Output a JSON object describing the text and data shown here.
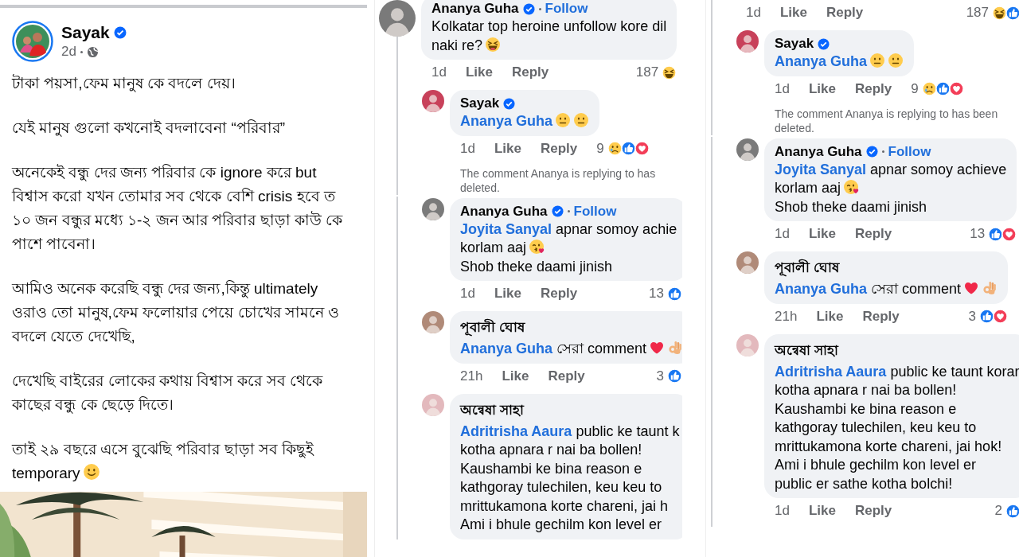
{
  "post": {
    "author": "Sayak",
    "verified": true,
    "time": "2d",
    "paragraphs": [
      {
        "lines": [
          {
            "text": "টাকা পয়সা,ফেম মানুষ কে বদলে দেয়।"
          }
        ]
      },
      {
        "lines": [
          {
            "text": "যেই মানুষ গুলো কখনোই বদলাবেনা “পরিবার”"
          }
        ]
      },
      {
        "lines": [
          {
            "text": "অনেকেই বন্ধু দের জন্য পরিবার কে ignore করে but"
          },
          {
            "text": "বিশ্বাস করো যখন তোমার সব থেকে বেশি crisis হবে ত"
          },
          {
            "text": "১০ জন বন্ধুর মধ্যে ১-২ জন আর পরিবার ছাড়া কাউ কে"
          },
          {
            "text": "পাশে পাবেনা।"
          }
        ]
      },
      {
        "lines": [
          {
            "text": "আমিও অনেক করেছি বন্ধু দের জন্য,কিন্তু ultimately"
          },
          {
            "text": "ওরাও তো মানুষ,ফেম ফলোয়ার পেয়ে চোখের সামনে ও"
          },
          {
            "text": "বদলে যেতে দেখেছি,"
          }
        ]
      },
      {
        "lines": [
          {
            "text": "দেখেছি বাইরের লোকের কথায় বিশ্বাস করে সব থেকে"
          },
          {
            "text": "কাছের বন্ধু কে ছেড়ে দিতে।"
          }
        ]
      },
      {
        "lines": [
          {
            "text": "তাই ২৯ বছরে এসে বুঝেছি পরিবার ছাড়া সব কিছুই"
          },
          {
            "text": "temporary",
            "emojis": [
              {
                "kind": "smile"
              }
            ]
          }
        ]
      }
    ]
  },
  "threads": [
    {
      "items": [
        {
          "kind": "comment",
          "author": "Ananya Guha",
          "verified": true,
          "follow": "Follow",
          "color": "#7a7a7a",
          "lines": [
            {
              "text": "Kolkatar top heroine unfollow kore dil"
            },
            {
              "text": "naki re?",
              "emojis": [
                {
                  "kind": "laugh"
                }
              ]
            }
          ],
          "meta": {
            "time": "1d",
            "like": "Like",
            "reply": "Reply",
            "count": "187",
            "reactions": [
              {
                "kind": "haha"
              }
            ]
          }
        },
        {
          "kind": "reply",
          "author": "Sayak",
          "verified": true,
          "color": "#c8415a",
          "lines": [
            {
              "mention": "Ananya Guha",
              "emojis": [
                {
                  "kind": "neutral"
                },
                {
                  "kind": "neutral"
                }
              ]
            }
          ],
          "meta": {
            "time": "1d",
            "like": "Like",
            "reply": "Reply",
            "count": "9",
            "reactions": [
              {
                "kind": "sad"
              },
              {
                "kind": "like"
              },
              {
                "kind": "love"
              }
            ]
          }
        },
        {
          "kind": "notice",
          "lines": [
            "The comment Ananya is replying to has",
            "deleted."
          ]
        },
        {
          "kind": "reply",
          "author": "Ananya Guha",
          "verified": true,
          "follow": "Follow",
          "color": "#7a7a7a",
          "lines": [
            {
              "mention": "Joyita Sanyal",
              "text": "apnar somoy achie"
            },
            {
              "text": "korlam aaj",
              "emojis": [
                {
                  "kind": "kiss"
                }
              ]
            },
            {
              "text": "Shob theke daami jinish"
            }
          ],
          "meta": {
            "time": "1d",
            "like": "Like",
            "reply": "Reply",
            "count": "13",
            "reactions": [
              {
                "kind": "like"
              }
            ]
          }
        },
        {
          "kind": "reply",
          "author": "পূবালী ঘোষ",
          "verified": false,
          "color": "#b08a78",
          "lines": [
            {
              "mention": "Ananya Guha",
              "text": "সেরা comment",
              "emojis": [
                {
                  "kind": "heart"
                },
                {
                  "kind": "ok"
                }
              ]
            }
          ],
          "meta": {
            "time": "21h",
            "like": "Like",
            "reply": "Reply",
            "count": "3",
            "reactions": [
              {
                "kind": "like"
              }
            ]
          }
        },
        {
          "kind": "reply",
          "author": "অন্বেষা সাহা",
          "verified": false,
          "color": "#e3b9bd",
          "lines": [
            {
              "mention": "Adritrisha Aaura",
              "text": "public ke taunt k"
            },
            {
              "text": "kotha apnara r nai ba bollen!"
            },
            {
              "text": "Kaushambi ke bina reason e"
            },
            {
              "text": "kathgoray tulechilen, keu keu to"
            },
            {
              "text": "mrittukamona korte chareni, jai h"
            },
            {
              "text": "Ami i bhule gechilm kon level er"
            }
          ]
        }
      ]
    },
    {
      "items": [
        {
          "kind": "meta",
          "meta": {
            "time": "1d",
            "like": "Like",
            "reply": "Reply",
            "count": "187",
            "reactions": [
              {
                "kind": "haha"
              },
              {
                "kind": "like"
              }
            ]
          }
        },
        {
          "kind": "reply",
          "author": "Sayak",
          "verified": true,
          "color": "#c8415a",
          "lines": [
            {
              "mention": "Ananya Guha",
              "emojis": [
                {
                  "kind": "neutral"
                },
                {
                  "kind": "neutral"
                }
              ]
            }
          ],
          "meta": {
            "time": "1d",
            "like": "Like",
            "reply": "Reply",
            "count": "9",
            "reactions": [
              {
                "kind": "sad"
              },
              {
                "kind": "like"
              },
              {
                "kind": "love"
              }
            ]
          }
        },
        {
          "kind": "notice",
          "lines": [
            "The comment Ananya is replying to has been",
            "deleted."
          ]
        },
        {
          "kind": "reply",
          "author": "Ananya Guha",
          "verified": true,
          "follow": "Follow",
          "color": "#7a7a7a",
          "lines": [
            {
              "mention": "Joyita Sanyal",
              "text": "apnar somoy achieve"
            },
            {
              "text": "korlam aaj",
              "emojis": [
                {
                  "kind": "kiss"
                }
              ]
            },
            {
              "text": "Shob theke daami jinish"
            }
          ],
          "meta": {
            "time": "1d",
            "like": "Like",
            "reply": "Reply",
            "count": "13",
            "reactions": [
              {
                "kind": "like"
              },
              {
                "kind": "love"
              }
            ]
          }
        },
        {
          "kind": "reply",
          "author": "পূবালী ঘোষ",
          "verified": false,
          "color": "#b08a78",
          "lines": [
            {
              "mention": "Ananya Guha",
              "text": "সেরা comment",
              "emojis": [
                {
                  "kind": "heart"
                },
                {
                  "kind": "ok"
                }
              ]
            }
          ],
          "meta": {
            "time": "21h",
            "like": "Like",
            "reply": "Reply",
            "count": "3",
            "reactions": [
              {
                "kind": "like"
              },
              {
                "kind": "love"
              }
            ]
          }
        },
        {
          "kind": "reply",
          "author": "অন্বেষা সাহা",
          "verified": false,
          "color": "#e3b9bd",
          "lines": [
            {
              "mention": "Adritrisha Aaura",
              "text": "public ke taunt korar"
            },
            {
              "text": "kotha apnara r nai ba bollen!"
            },
            {
              "text": "Kaushambi ke bina reason e"
            },
            {
              "text": "kathgoray tulechilen, keu keu to"
            },
            {
              "text": "mrittukamona korte chareni, jai hok!"
            },
            {
              "text": "Ami i bhule gechilm kon level er"
            },
            {
              "text": "public er sathe kotha bolchi!"
            }
          ],
          "meta": {
            "time": "1d",
            "like": "Like",
            "reply": "Reply",
            "count": "2",
            "reactions": [
              {
                "kind": "like"
              }
            ]
          }
        }
      ]
    }
  ]
}
